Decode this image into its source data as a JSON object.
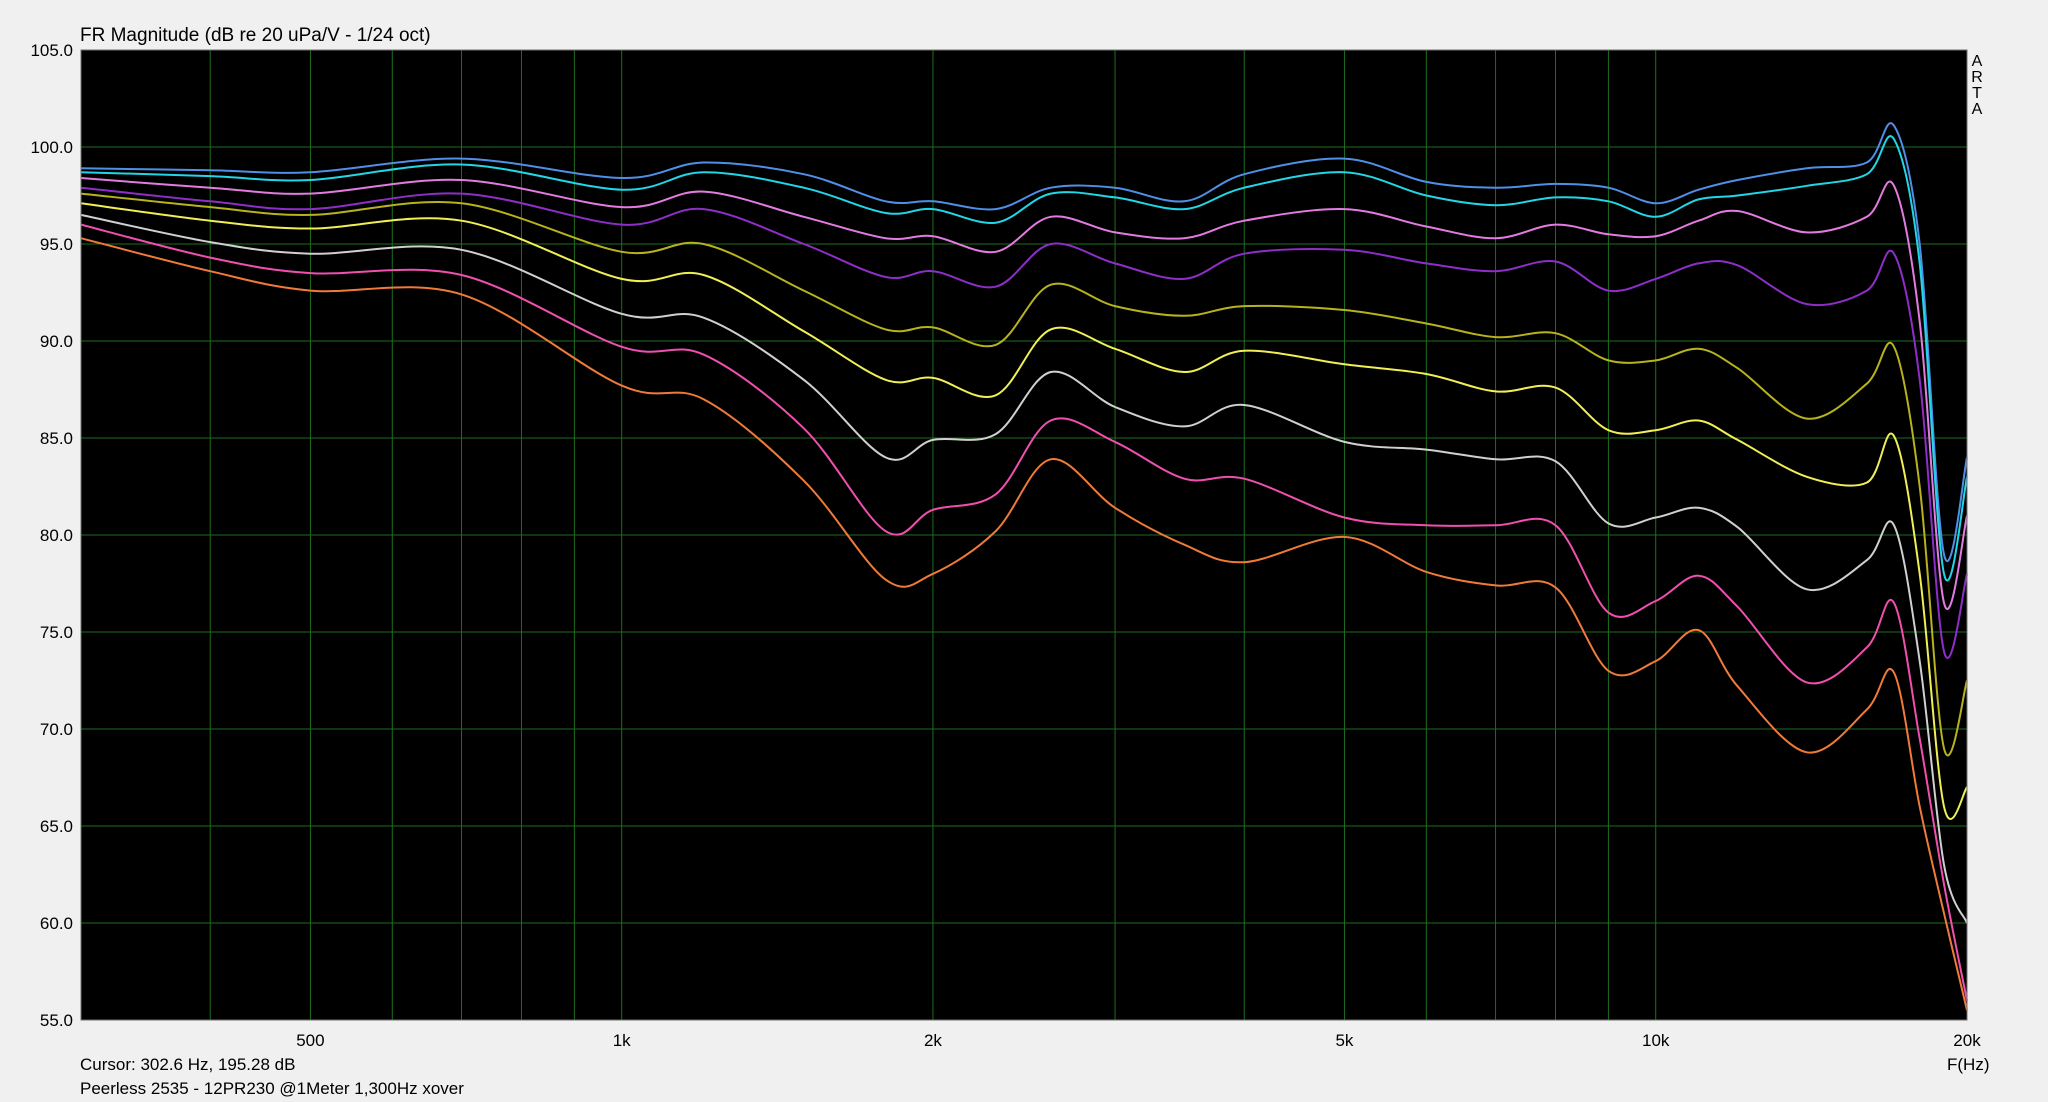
{
  "window": {
    "cursor_readout": "Cursor: 302.6 Hz, 195.28 dB",
    "caption": "Peerless 2535 - 12PR230 @1Meter 1,300Hz xover",
    "brand_vertical": [
      "A",
      "R",
      "T",
      "A"
    ]
  },
  "colors": {
    "plot_background": "#000000",
    "grid": "#1e6e1e",
    "page_background": "#f0f0f0"
  },
  "chart_data": {
    "type": "line",
    "title": "FR Magnitude (dB re 20 uPa/V - 1/24 oct)",
    "xlabel": "F(Hz)",
    "ylabel": "",
    "x_scale": "log",
    "xlim": [
      300,
      20000
    ],
    "ylim": [
      55,
      105
    ],
    "grid": true,
    "y_ticks": [
      "55.0",
      "60.0",
      "65.0",
      "70.0",
      "75.0",
      "80.0",
      "85.0",
      "90.0",
      "95.0",
      "100.0",
      "105.0"
    ],
    "x_ticks": [
      {
        "value": 500,
        "label": "500"
      },
      {
        "value": 1000,
        "label": "1k"
      },
      {
        "value": 2000,
        "label": "2k"
      },
      {
        "value": 5000,
        "label": "5k"
      },
      {
        "value": 10000,
        "label": "10k"
      },
      {
        "value": 20000,
        "label": "20k"
      }
    ],
    "x_grid": [
      400,
      500,
      600,
      700,
      800,
      900,
      1000,
      2000,
      3000,
      4000,
      5000,
      6000,
      7000,
      8000,
      9000,
      10000,
      20000
    ],
    "x": [
      300,
      400,
      500,
      700,
      1000,
      1200,
      1500,
      1800,
      2000,
      2300,
      2600,
      3000,
      3500,
      4000,
      5000,
      6000,
      7000,
      8000,
      9000,
      10000,
      11000,
      12000,
      14000,
      16000,
      17000,
      18000,
      19000,
      20000
    ],
    "series": [
      {
        "color": "#4f8fe8",
        "values": [
          98.9,
          98.8,
          98.7,
          99.4,
          98.4,
          99.2,
          98.6,
          97.2,
          97.2,
          96.8,
          97.9,
          97.9,
          97.2,
          98.6,
          99.4,
          98.2,
          97.9,
          98.1,
          97.9,
          97.1,
          97.8,
          98.3,
          98.9,
          99.2,
          101.1,
          95.0,
          79.0,
          84.0
        ]
      },
      {
        "color": "#22d6e6",
        "values": [
          98.7,
          98.5,
          98.3,
          99.1,
          97.8,
          98.7,
          97.9,
          96.6,
          96.8,
          96.1,
          97.6,
          97.4,
          96.8,
          97.9,
          98.7,
          97.5,
          97.0,
          97.4,
          97.2,
          96.4,
          97.3,
          97.5,
          98.0,
          98.6,
          100.4,
          94.0,
          78.0,
          83.0
        ]
      },
      {
        "color": "#e37be0",
        "values": [
          98.4,
          97.9,
          97.6,
          98.3,
          96.9,
          97.7,
          96.4,
          95.3,
          95.4,
          94.6,
          96.4,
          95.6,
          95.3,
          96.2,
          96.8,
          95.9,
          95.3,
          96.0,
          95.5,
          95.4,
          96.2,
          96.7,
          95.6,
          96.4,
          98.0,
          91.0,
          76.5,
          81.0
        ]
      },
      {
        "color": "#8e2ec8",
        "values": [
          97.9,
          97.2,
          96.8,
          97.6,
          96.0,
          96.8,
          95.0,
          93.3,
          93.6,
          92.8,
          95.0,
          94.0,
          93.2,
          94.5,
          94.7,
          94.0,
          93.6,
          94.1,
          92.6,
          93.2,
          94.0,
          93.9,
          91.9,
          92.6,
          94.5,
          88.0,
          74.0,
          78.0
        ]
      },
      {
        "color": "#b7b21d",
        "values": [
          97.6,
          96.9,
          96.5,
          97.1,
          94.6,
          95.0,
          92.6,
          90.6,
          90.7,
          89.8,
          92.9,
          91.8,
          91.3,
          91.8,
          91.6,
          90.9,
          90.2,
          90.4,
          89.0,
          89.0,
          89.6,
          88.6,
          86.0,
          87.8,
          89.7,
          82.5,
          69.0,
          72.5
        ]
      },
      {
        "color": "#f0ef55",
        "values": [
          97.1,
          96.2,
          95.8,
          96.2,
          93.2,
          93.4,
          90.5,
          88.0,
          88.1,
          87.2,
          90.6,
          89.6,
          88.4,
          89.5,
          88.8,
          88.3,
          87.4,
          87.6,
          85.4,
          85.4,
          85.9,
          84.9,
          83.0,
          82.7,
          85.1,
          78.0,
          66.0,
          67.0
        ]
      },
      {
        "color": "#d0d0d0",
        "values": [
          96.5,
          95.1,
          94.5,
          94.7,
          91.4,
          91.2,
          88.0,
          84.0,
          84.9,
          85.2,
          88.4,
          86.6,
          85.6,
          86.7,
          84.8,
          84.4,
          83.9,
          83.8,
          80.6,
          80.9,
          81.4,
          80.4,
          77.2,
          78.7,
          80.5,
          73.5,
          63.0,
          60.0
        ]
      },
      {
        "color": "#f04fb0",
        "values": [
          96.0,
          94.3,
          93.5,
          93.4,
          89.7,
          89.3,
          85.5,
          80.2,
          81.3,
          82.1,
          85.9,
          84.8,
          82.9,
          82.9,
          80.9,
          80.5,
          80.5,
          80.5,
          76.0,
          76.6,
          77.9,
          76.3,
          72.4,
          74.2,
          76.5,
          69.5,
          62.0,
          56.0
        ]
      },
      {
        "color": "#f07a3a",
        "values": [
          95.3,
          93.6,
          92.6,
          92.4,
          87.7,
          87.0,
          82.8,
          77.7,
          78.0,
          80.2,
          83.9,
          81.4,
          79.5,
          78.6,
          79.9,
          78.1,
          77.4,
          77.3,
          73.0,
          73.5,
          75.1,
          72.2,
          68.8,
          71.0,
          72.9,
          66.0,
          60.5,
          55.5
        ]
      }
    ]
  }
}
